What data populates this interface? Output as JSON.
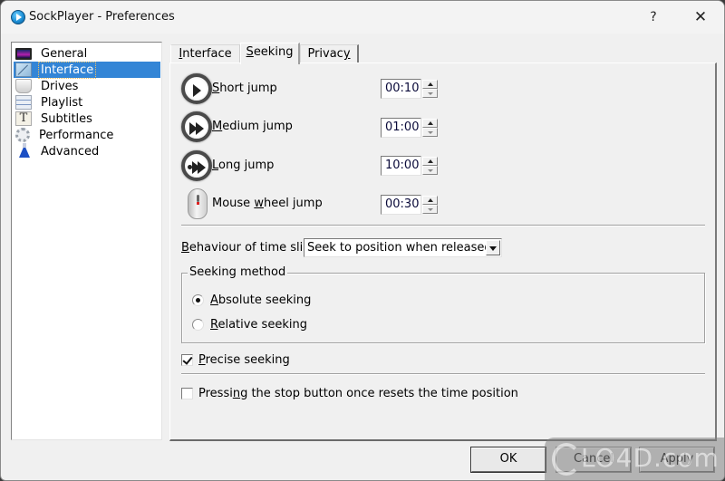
{
  "window": {
    "title": "SockPlayer - Preferences",
    "help_label": "?",
    "close_label": "✕"
  },
  "sidebar": {
    "items": [
      {
        "label": "General",
        "icon": "monitor-icon",
        "selected": false
      },
      {
        "label": "Interface",
        "icon": "interface-icon",
        "selected": true
      },
      {
        "label": "Drives",
        "icon": "drive-icon",
        "selected": false
      },
      {
        "label": "Playlist",
        "icon": "playlist-icon",
        "selected": false
      },
      {
        "label": "Subtitles",
        "icon": "subtitles-icon",
        "selected": false
      },
      {
        "label": "Performance",
        "icon": "gear-icon",
        "selected": false
      },
      {
        "label": "Advanced",
        "icon": "flask-icon",
        "selected": false
      }
    ]
  },
  "tabs": [
    {
      "label": "Interface",
      "accel": "I",
      "rest": "nterface",
      "active": false
    },
    {
      "label": "Seeking",
      "accel": "S",
      "rest": "eeking",
      "active": true
    },
    {
      "label": "Privacy",
      "pre": "Privac",
      "accel": "y",
      "active": false
    }
  ],
  "seeking": {
    "jumps": [
      {
        "accel": "S",
        "rest": "hort jump",
        "label": "Short jump",
        "value": "00:10",
        "icon": "play-icon"
      },
      {
        "accel": "M",
        "rest": "edium jump",
        "label": "Medium jump",
        "value": "01:00",
        "icon": "fast-forward-icon"
      },
      {
        "accel": "L",
        "rest": "ong jump",
        "label": "Long jump",
        "value": "10:00",
        "icon": "skip-forward-icon"
      },
      {
        "pre": "Mouse ",
        "accel": "w",
        "rest": "heel jump",
        "label": "Mouse wheel jump",
        "value": "00:30",
        "icon": "mouse-icon"
      }
    ],
    "slider_label_accel": "B",
    "slider_label_rest": "ehaviour of time slider:",
    "slider_behaviour": "Seek to position when released",
    "method_title": "Seeking method",
    "methods": [
      {
        "accel": "A",
        "rest": "bsolute seeking",
        "checked": true
      },
      {
        "accel": "R",
        "rest": "elative seeking",
        "checked": false
      }
    ],
    "precise": {
      "accel": "P",
      "rest": "recise seeking",
      "checked": true
    },
    "stop_reset": {
      "pre": "Pressi",
      "accel": "n",
      "rest": "g the stop button once resets the time position",
      "checked": false
    }
  },
  "buttons": {
    "ok": "OK",
    "cancel": "Cancel",
    "apply": "Apply"
  },
  "watermark": {
    "text": "LO4D.com"
  }
}
